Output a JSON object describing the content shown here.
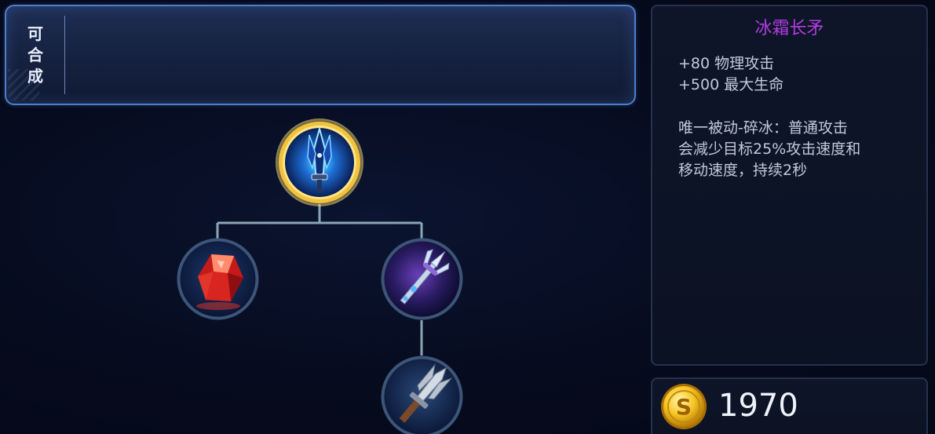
{
  "craft_bar": {
    "label_chars": [
      "可",
      "合",
      "成"
    ]
  },
  "item_tree": {
    "root": {
      "icon": "frost-spear-icon",
      "selected": true
    },
    "components": [
      {
        "icon": "red-crystal-icon"
      },
      {
        "icon": "violet-trident-icon"
      }
    ],
    "sub_components": [
      {
        "icon": "iron-sword-icon"
      }
    ],
    "colors": {
      "connector": "#8aa6b4",
      "selected_ring": "#f2c33a",
      "ring": "#3c5578"
    }
  },
  "item_detail": {
    "name": "冰霜长矛",
    "name_color": "#b13de0",
    "stats": [
      "+80 物理攻击",
      "+500 最大生命"
    ],
    "passive_lines": [
      "唯一被动-碎冰：普通攻击",
      "会减少目标25%攻击速度和",
      "移动速度，持续2秒"
    ]
  },
  "price": {
    "icon": "gold-coin-icon",
    "value": "1970"
  }
}
